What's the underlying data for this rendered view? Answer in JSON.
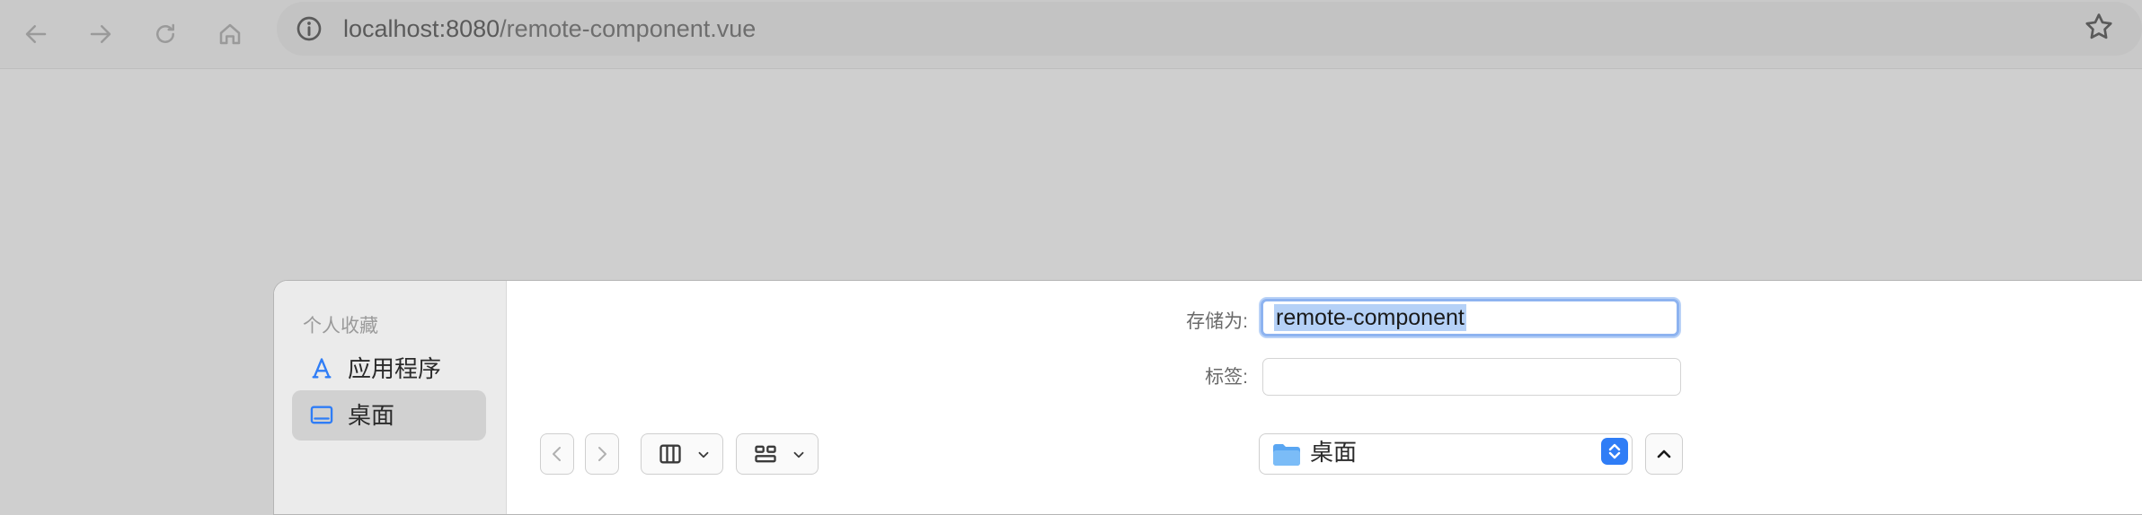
{
  "browser": {
    "url_host": "localhost:8080",
    "url_path": "/remote-component.vue",
    "icons": {
      "back": "arrow-left-icon",
      "forward": "arrow-right-icon",
      "reload": "reload-icon",
      "home": "home-icon",
      "info": "info-icon",
      "bookmark": "star-icon"
    }
  },
  "dialog": {
    "sidebar": {
      "section_title": "个人收藏",
      "items": [
        {
          "label": "应用程序",
          "icon": "applications-icon",
          "selected": false
        },
        {
          "label": "桌面",
          "icon": "desktop-icon",
          "selected": true
        }
      ]
    },
    "form": {
      "save_as_label": "存储为:",
      "save_as_value": "remote-component",
      "tags_label": "标签:",
      "tags_value": ""
    },
    "toolbar": {
      "location_label": "桌面"
    }
  },
  "colors": {
    "accent": "#2f7df6",
    "selection": "#b5d1f7",
    "focus_ring": "#8db3f0"
  }
}
